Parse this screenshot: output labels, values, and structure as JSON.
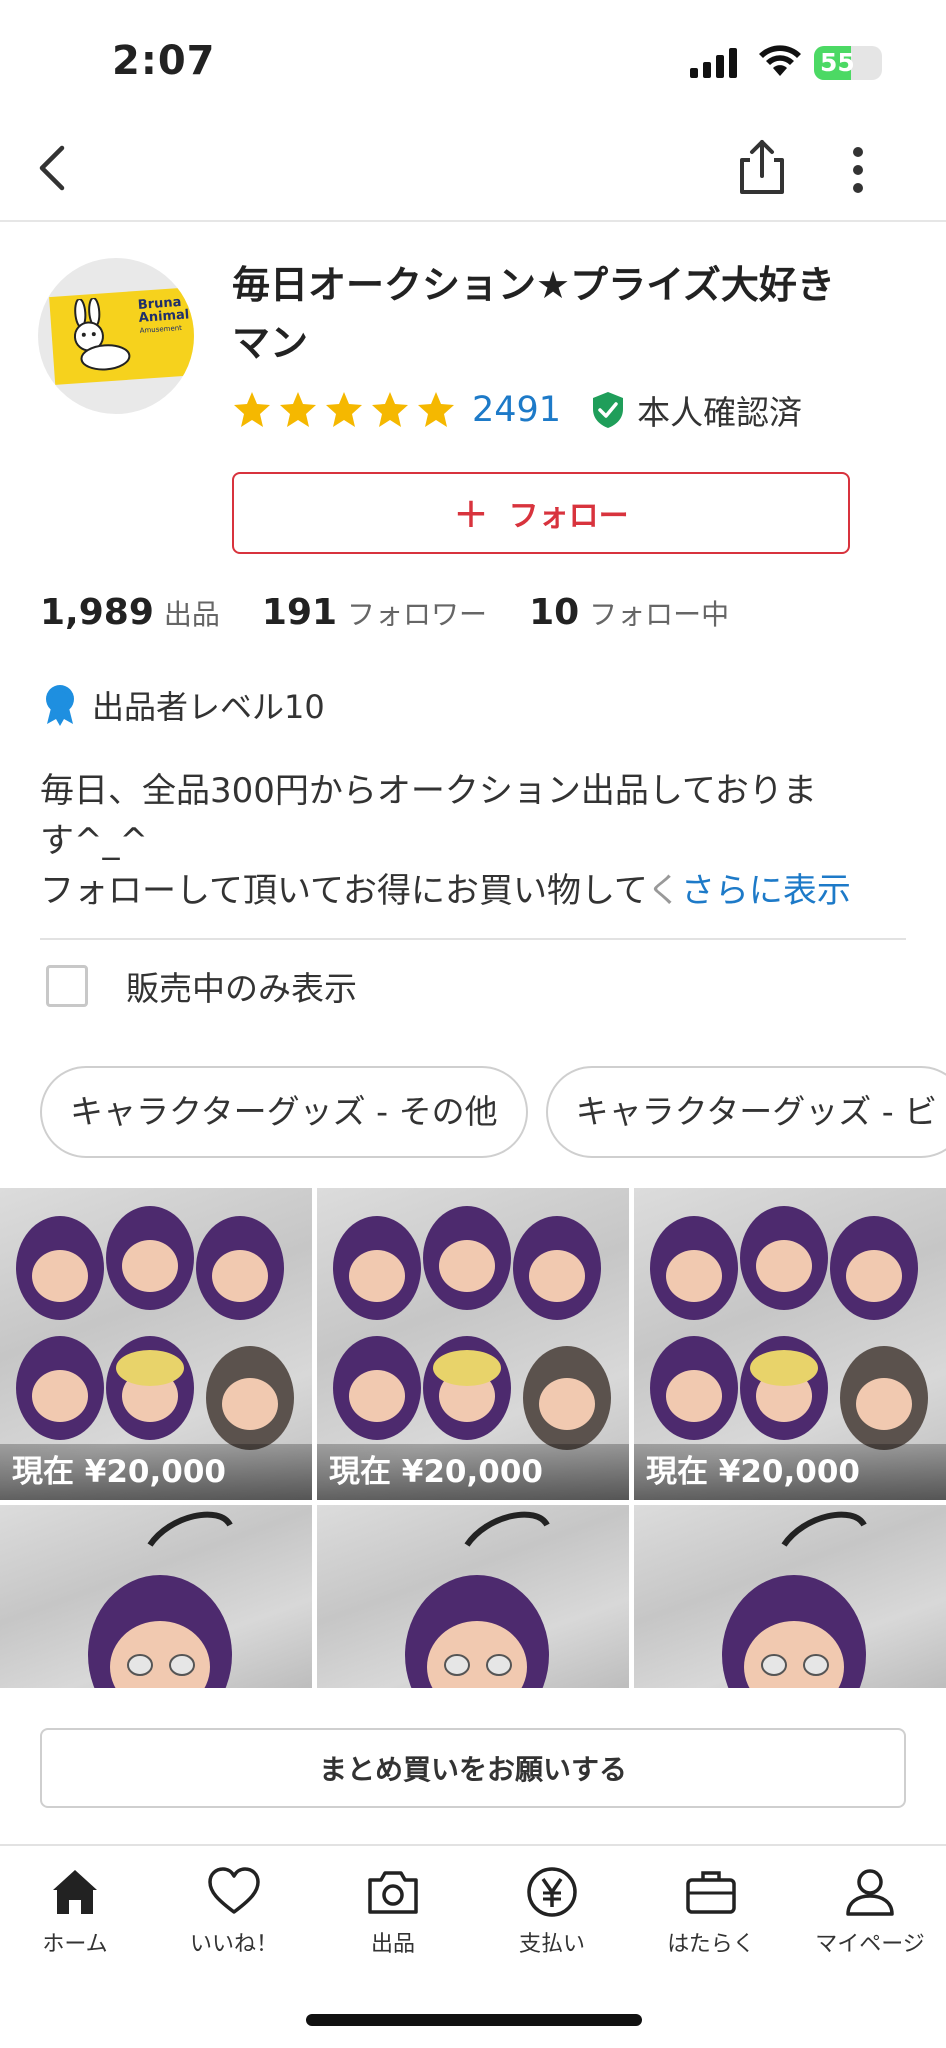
{
  "status_bar": {
    "time": "2:07",
    "battery": "55",
    "battery_level": 0.55
  },
  "profile": {
    "name": "毎日オークション★プライズ大好きマン",
    "avatar_text": "Bruna Animal",
    "avatar_subtext": "Amusement",
    "rating_stars": 5,
    "rating_count": "2491",
    "verified_label": "本人確認済",
    "follow_label": "フォロー"
  },
  "stats": [
    {
      "num": "1,989",
      "label": "出品"
    },
    {
      "num": "191",
      "label": "フォロワー"
    },
    {
      "num": "10",
      "label": "フォロー中"
    }
  ],
  "seller_level": "出品者レベル10",
  "description": {
    "line1": "毎日、全品300円からオークション出品しておりま",
    "line2": "す^_^",
    "line3": "フォローして頂いてお得にお買い物して",
    "truncation": "く",
    "more": "さらに表示"
  },
  "filter": {
    "on_sale_only": "販売中のみ表示"
  },
  "chips": [
    "キャラクターグッズ - その他",
    "キャラクターグッズ - ビ"
  ],
  "items": [
    {
      "price": "現在 ¥20,000"
    },
    {
      "price": "現在 ¥20,000"
    },
    {
      "price": "現在 ¥20,000"
    },
    {
      "price": ""
    },
    {
      "price": ""
    },
    {
      "price": ""
    }
  ],
  "bulk_button": "まとめ買いをお願いする",
  "tabs": [
    {
      "icon": "home-icon",
      "label": "ホーム"
    },
    {
      "icon": "heart-icon",
      "label": "いいね！"
    },
    {
      "icon": "camera-icon",
      "label": "出品"
    },
    {
      "icon": "yen-icon",
      "label": "支払い"
    },
    {
      "icon": "briefcase-icon",
      "label": "はたらく"
    },
    {
      "icon": "person-icon",
      "label": "マイページ"
    }
  ],
  "colors": {
    "accent_red": "#d8333d",
    "link_blue": "#1d7ac8",
    "star": "#f5b800",
    "verified_green": "#1f9e5a",
    "badge_blue": "#1e8fe0"
  }
}
